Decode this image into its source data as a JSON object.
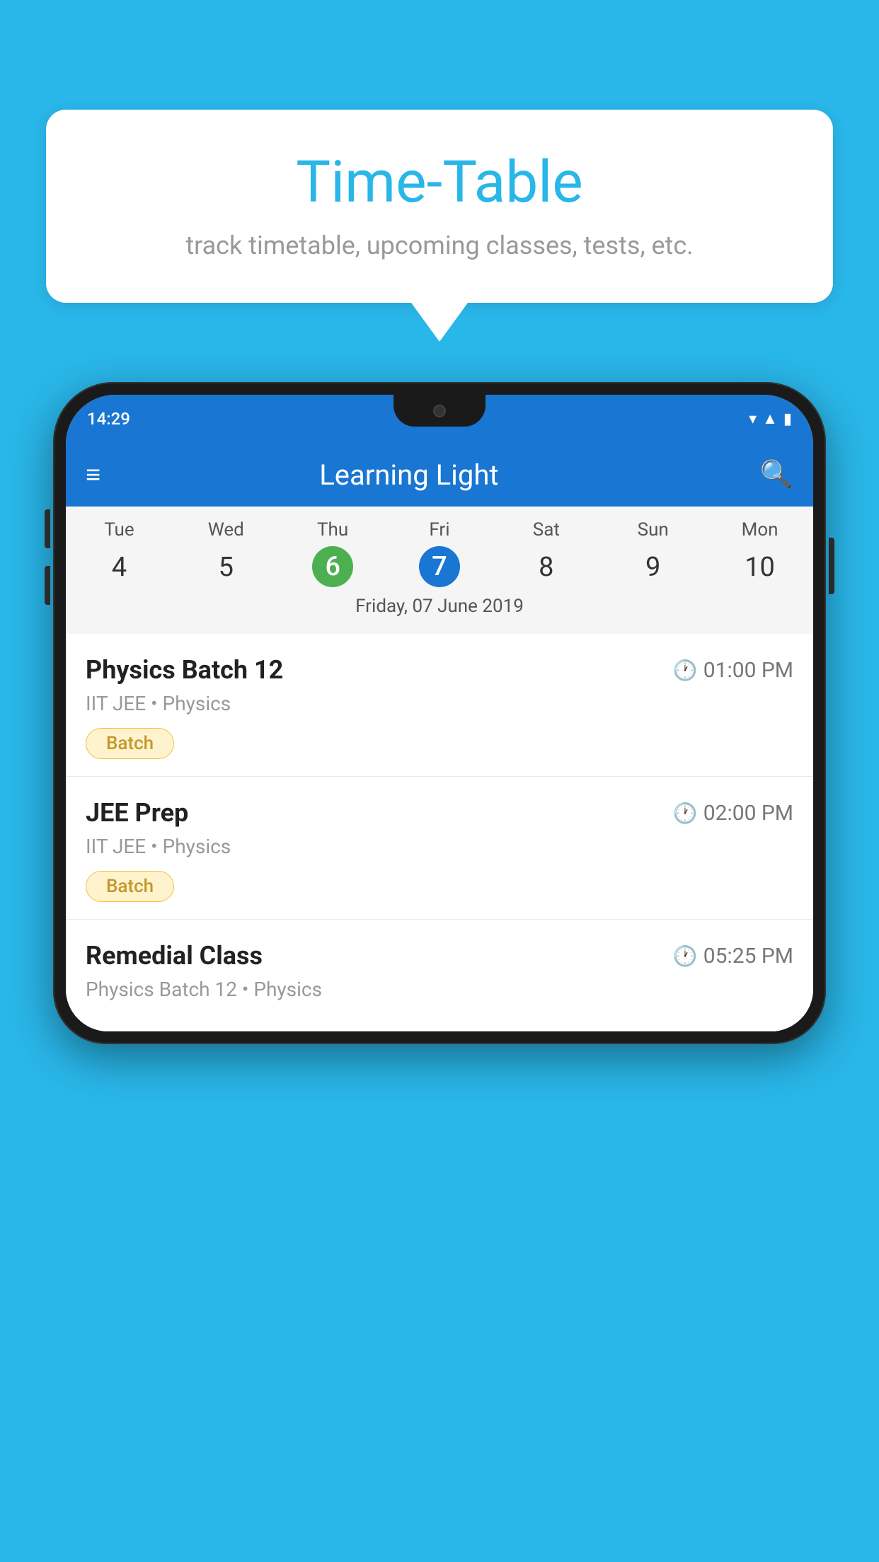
{
  "background_color": "#29b6e8",
  "speech_bubble": {
    "title": "Time-Table",
    "subtitle": "track timetable, upcoming classes, tests, etc."
  },
  "phone": {
    "status_bar": {
      "time": "14:29",
      "icons": [
        "wifi",
        "signal",
        "battery"
      ]
    },
    "app_bar": {
      "title": "Learning Light"
    },
    "calendar": {
      "days": [
        {
          "name": "Tue",
          "num": "4"
        },
        {
          "name": "Wed",
          "num": "5"
        },
        {
          "name": "Thu",
          "num": "6"
        },
        {
          "name": "Fri",
          "num": "7"
        },
        {
          "name": "Sat",
          "num": "8"
        },
        {
          "name": "Sun",
          "num": "9"
        },
        {
          "name": "Mon",
          "num": "10"
        }
      ],
      "current_date": "Friday, 07 June 2019"
    },
    "classes": [
      {
        "name": "Physics Batch 12",
        "time": "01:00 PM",
        "subject": "IIT JEE • Physics",
        "badge": "Batch"
      },
      {
        "name": "JEE Prep",
        "time": "02:00 PM",
        "subject": "IIT JEE • Physics",
        "badge": "Batch"
      },
      {
        "name": "Remedial Class",
        "time": "05:25 PM",
        "subject": "Physics Batch 12 • Physics",
        "badge": ""
      }
    ]
  }
}
